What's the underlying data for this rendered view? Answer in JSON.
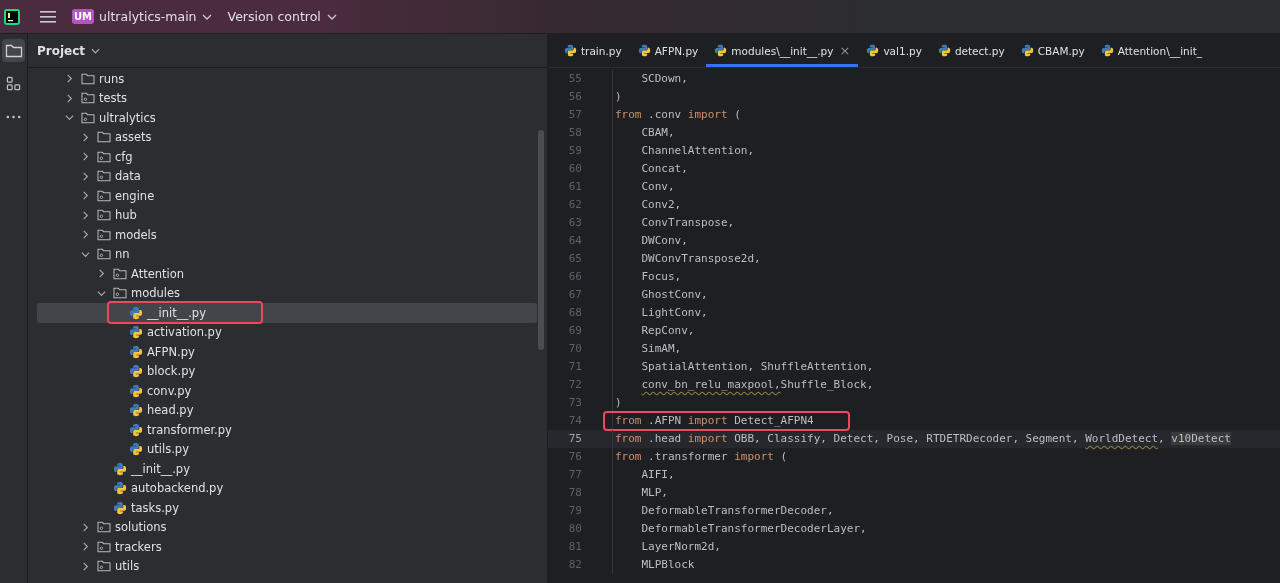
{
  "title_bar": {
    "project_badge": "UM",
    "project": "ultralytics-main",
    "vcs": "Version control"
  },
  "sidebar": {
    "tools": [
      {
        "kind": "project",
        "selected": true
      },
      {
        "kind": "structure",
        "selected": false
      },
      {
        "kind": "more",
        "selected": false
      }
    ]
  },
  "project_panel": {
    "title": "Project",
    "tree": [
      {
        "label": "runs",
        "kind": "folder",
        "expanded": false,
        "selected": false,
        "boxed": false
      },
      {
        "label": "tests",
        "kind": "package",
        "expanded": false,
        "selected": false,
        "boxed": false
      },
      {
        "label": "ultralytics",
        "kind": "package",
        "expanded": true,
        "selected": false,
        "boxed": false,
        "children": [
          {
            "label": "assets",
            "kind": "folder",
            "expanded": false,
            "selected": false,
            "boxed": false
          },
          {
            "label": "cfg",
            "kind": "package",
            "expanded": false,
            "selected": false,
            "boxed": false
          },
          {
            "label": "data",
            "kind": "package",
            "expanded": false,
            "selected": false,
            "boxed": false
          },
          {
            "label": "engine",
            "kind": "package",
            "expanded": false,
            "selected": false,
            "boxed": false
          },
          {
            "label": "hub",
            "kind": "package",
            "expanded": false,
            "selected": false,
            "boxed": false
          },
          {
            "label": "models",
            "kind": "package",
            "expanded": false,
            "selected": false,
            "boxed": false
          },
          {
            "label": "nn",
            "kind": "package",
            "expanded": true,
            "selected": false,
            "boxed": false,
            "children": [
              {
                "label": "Attention",
                "kind": "package",
                "expanded": false,
                "selected": false,
                "boxed": false
              },
              {
                "label": "modules",
                "kind": "package",
                "expanded": true,
                "selected": false,
                "boxed": false,
                "children": [
                  {
                    "label": "__init__.py",
                    "kind": "file",
                    "selected": true,
                    "boxed": true
                  },
                  {
                    "label": "activation.py",
                    "kind": "file",
                    "selected": false,
                    "boxed": false
                  },
                  {
                    "label": "AFPN.py",
                    "kind": "file",
                    "selected": false,
                    "boxed": false
                  },
                  {
                    "label": "block.py",
                    "kind": "file",
                    "selected": false,
                    "boxed": false
                  },
                  {
                    "label": "conv.py",
                    "kind": "file",
                    "selected": false,
                    "boxed": false
                  },
                  {
                    "label": "head.py",
                    "kind": "file",
                    "selected": false,
                    "boxed": false
                  },
                  {
                    "label": "transformer.py",
                    "kind": "file",
                    "selected": false,
                    "boxed": false
                  },
                  {
                    "label": "utils.py",
                    "kind": "file",
                    "selected": false,
                    "boxed": false
                  }
                ]
              },
              {
                "label": "__init__.py",
                "kind": "file",
                "selected": false,
                "boxed": false
              },
              {
                "label": "autobackend.py",
                "kind": "file",
                "selected": false,
                "boxed": false
              },
              {
                "label": "tasks.py",
                "kind": "file",
                "selected": false,
                "boxed": false
              }
            ]
          },
          {
            "label": "solutions",
            "kind": "package",
            "expanded": false,
            "selected": false,
            "boxed": false
          },
          {
            "label": "trackers",
            "kind": "package",
            "expanded": false,
            "selected": false,
            "boxed": false
          },
          {
            "label": "utils",
            "kind": "package",
            "expanded": false,
            "selected": false,
            "boxed": false
          }
        ]
      }
    ]
  },
  "tabs": [
    {
      "label": "train.py",
      "selected": false
    },
    {
      "label": "AFPN.py",
      "selected": false
    },
    {
      "label": "modules\\__init__.py",
      "selected": true,
      "close": "×"
    },
    {
      "label": "val1.py",
      "selected": false
    },
    {
      "label": "detect.py",
      "selected": false
    },
    {
      "label": "CBAM.py",
      "selected": false
    },
    {
      "label": "Attention\\__init_",
      "selected": false
    }
  ],
  "editor": {
    "lines": [
      {
        "number": "55",
        "current": false,
        "boxed": false,
        "tokens": [
          {
            "text": "    SCDown,",
            "kind": "plain"
          }
        ]
      },
      {
        "number": "56",
        "current": false,
        "boxed": false,
        "tokens": [
          {
            "text": ")",
            "kind": "plain"
          }
        ]
      },
      {
        "number": "57",
        "current": false,
        "boxed": false,
        "tokens": [
          {
            "text": "from",
            "kind": "keyword"
          },
          {
            "text": " .conv ",
            "kind": "plain"
          },
          {
            "text": "import",
            "kind": "keyword"
          },
          {
            "text": " (",
            "kind": "plain"
          }
        ]
      },
      {
        "number": "58",
        "current": false,
        "boxed": false,
        "tokens": [
          {
            "text": "    CBAM,",
            "kind": "plain"
          }
        ]
      },
      {
        "number": "59",
        "current": false,
        "boxed": false,
        "tokens": [
          {
            "text": "    ChannelAttention,",
            "kind": "plain"
          }
        ]
      },
      {
        "number": "60",
        "current": false,
        "boxed": false,
        "tokens": [
          {
            "text": "    Concat,",
            "kind": "plain"
          }
        ]
      },
      {
        "number": "61",
        "current": false,
        "boxed": false,
        "tokens": [
          {
            "text": "    Conv,",
            "kind": "plain"
          }
        ]
      },
      {
        "number": "62",
        "current": false,
        "boxed": false,
        "tokens": [
          {
            "text": "    Conv2,",
            "kind": "plain"
          }
        ]
      },
      {
        "number": "63",
        "current": false,
        "boxed": false,
        "tokens": [
          {
            "text": "    ConvTranspose,",
            "kind": "plain"
          }
        ]
      },
      {
        "number": "64",
        "current": false,
        "boxed": false,
        "tokens": [
          {
            "text": "    DWConv,",
            "kind": "plain"
          }
        ]
      },
      {
        "number": "65",
        "current": false,
        "boxed": false,
        "tokens": [
          {
            "text": "    DWConvTranspose2d,",
            "kind": "plain"
          }
        ]
      },
      {
        "number": "66",
        "current": false,
        "boxed": false,
        "tokens": [
          {
            "text": "    Focus,",
            "kind": "plain"
          }
        ]
      },
      {
        "number": "67",
        "current": false,
        "boxed": false,
        "tokens": [
          {
            "text": "    GhostConv,",
            "kind": "plain"
          }
        ]
      },
      {
        "number": "68",
        "current": false,
        "boxed": false,
        "tokens": [
          {
            "text": "    LightConv,",
            "kind": "plain"
          }
        ]
      },
      {
        "number": "69",
        "current": false,
        "boxed": false,
        "tokens": [
          {
            "text": "    RepConv,",
            "kind": "plain"
          }
        ]
      },
      {
        "number": "70",
        "current": false,
        "boxed": false,
        "tokens": [
          {
            "text": "    SimAM,",
            "kind": "plain"
          }
        ]
      },
      {
        "number": "71",
        "current": false,
        "boxed": false,
        "tokens": [
          {
            "text": "    SpatialAttention, ShuffleAttention,",
            "kind": "plain"
          }
        ]
      },
      {
        "number": "72",
        "current": false,
        "boxed": false,
        "indent": true,
        "tokens": [
          {
            "text": "conv_bn_relu_maxpool,",
            "kind": "warning"
          },
          {
            "text": "Shuffle_Block,",
            "kind": "plain"
          }
        ]
      },
      {
        "number": "73",
        "current": false,
        "boxed": false,
        "tokens": [
          {
            "text": ")",
            "kind": "plain"
          }
        ]
      },
      {
        "number": "74",
        "current": false,
        "boxed": true,
        "tokens": [
          {
            "text": "from",
            "kind": "keyword"
          },
          {
            "text": " .AFPN ",
            "kind": "plain"
          },
          {
            "text": "import",
            "kind": "keyword"
          },
          {
            "text": " Detect_AFPN4",
            "kind": "plain"
          }
        ]
      },
      {
        "number": "75",
        "current": true,
        "boxed": false,
        "tokens": [
          {
            "text": "from",
            "kind": "keyword"
          },
          {
            "text": " .head ",
            "kind": "plain"
          },
          {
            "text": "import",
            "kind": "keyword"
          },
          {
            "text": " OBB, Classify, Detect, Pose, RTDETRDecoder, Segment, ",
            "kind": "plain"
          },
          {
            "text": "WorldDetect",
            "kind": "warning"
          },
          {
            "text": ", ",
            "kind": "plain"
          },
          {
            "text": "v10Detect",
            "kind": "highlight"
          }
        ]
      },
      {
        "number": "76",
        "current": false,
        "boxed": false,
        "tokens": [
          {
            "text": "from",
            "kind": "keyword"
          },
          {
            "text": " .transformer ",
            "kind": "plain"
          },
          {
            "text": "import",
            "kind": "keyword"
          },
          {
            "text": " (",
            "kind": "plain"
          }
        ]
      },
      {
        "number": "77",
        "current": false,
        "boxed": false,
        "tokens": [
          {
            "text": "    AIFI,",
            "kind": "plain"
          }
        ]
      },
      {
        "number": "78",
        "current": false,
        "boxed": false,
        "tokens": [
          {
            "text": "    MLP,",
            "kind": "plain"
          }
        ]
      },
      {
        "number": "79",
        "current": false,
        "boxed": false,
        "tokens": [
          {
            "text": "    DeformableTransformerDecoder,",
            "kind": "plain"
          }
        ]
      },
      {
        "number": "80",
        "current": false,
        "boxed": false,
        "tokens": [
          {
            "text": "    DeformableTransformerDecoderLayer,",
            "kind": "plain"
          }
        ]
      },
      {
        "number": "81",
        "current": false,
        "boxed": false,
        "tokens": [
          {
            "text": "    LayerNorm2d,",
            "kind": "plain"
          }
        ]
      },
      {
        "number": "82",
        "current": false,
        "boxed": false,
        "tokens": [
          {
            "text": "    MLPBlock",
            "kind": "plain"
          }
        ]
      }
    ]
  }
}
